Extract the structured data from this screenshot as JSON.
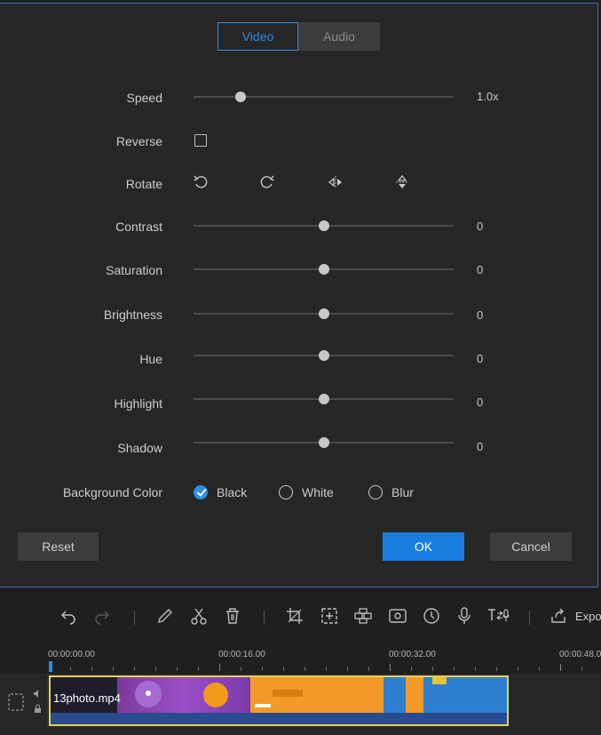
{
  "tabs": {
    "video": "Video",
    "audio": "Audio"
  },
  "settings": {
    "speed": {
      "label": "Speed",
      "value": "1.0x",
      "fraction": 0.18
    },
    "reverse": {
      "label": "Reverse",
      "checked": false
    },
    "rotate": {
      "label": "Rotate",
      "icons": [
        "rotate-left-icon",
        "rotate-right-icon",
        "flip-horizontal-icon",
        "flip-vertical-icon"
      ]
    },
    "contrast": {
      "label": "Contrast",
      "value": "0",
      "fraction": 0.5
    },
    "saturation": {
      "label": "Saturation",
      "value": "0",
      "fraction": 0.5
    },
    "brightness": {
      "label": "Brightness",
      "value": "0",
      "fraction": 0.5
    },
    "hue": {
      "label": "Hue",
      "value": "0",
      "fraction": 0.5
    },
    "highlight": {
      "label": "Highlight",
      "value": "0",
      "fraction": 0.5
    },
    "shadow": {
      "label": "Shadow",
      "value": "0",
      "fraction": 0.5
    },
    "background_color": {
      "label": "Background Color",
      "options": [
        "Black",
        "White",
        "Blur"
      ],
      "selected": "Black"
    }
  },
  "buttons": {
    "reset": "Reset",
    "ok": "OK",
    "cancel": "Cancel"
  },
  "toolbar": {
    "icons": [
      "undo-icon",
      "redo-icon",
      "edit-icon",
      "cut-icon",
      "delete-icon",
      "crop-icon",
      "zoom-icon",
      "mosaic-icon",
      "freeze-frame-icon",
      "duration-icon",
      "voiceover-icon",
      "speech-to-text-icon",
      "export-icon"
    ],
    "export_label": "Expor"
  },
  "timeline": {
    "times": [
      "00:00:00.00",
      "00:00:16.00",
      "00:00:32.00",
      "00:00:48.0"
    ],
    "clip_name": "13photo.mp4"
  },
  "colors": {
    "accent": "#2d8ce6",
    "dialog_bg": "#262626",
    "clip_border": "#e6d15a"
  }
}
